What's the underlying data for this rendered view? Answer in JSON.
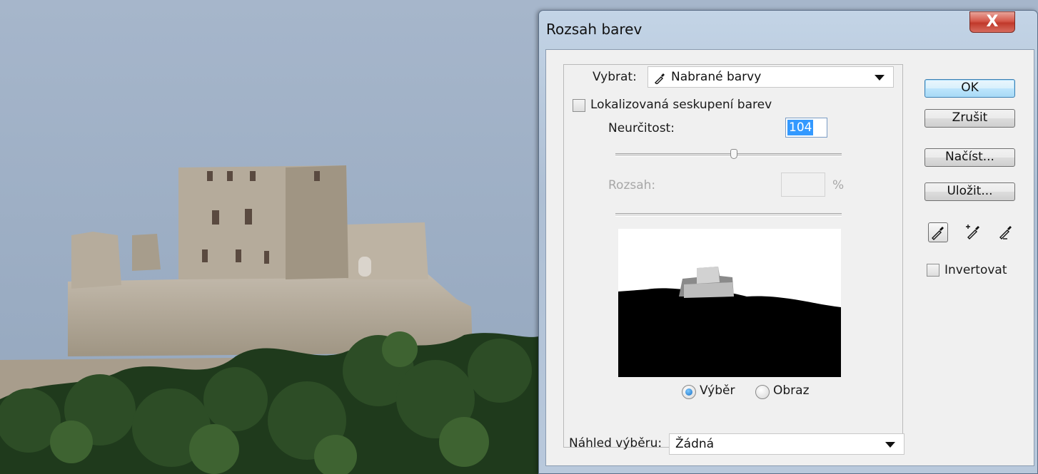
{
  "dialog": {
    "title": "Rozsah barev",
    "select_label": "Vybrat:",
    "select_value": "Nabrané barvy",
    "localized_label": "Lokalizovaná seskupení barev",
    "fuzziness_label": "Neurčitost:",
    "fuzziness_value": "104",
    "range_label": "Rozsah:",
    "range_unit": "%",
    "radio_selection": "Výběr",
    "radio_image": "Obraz",
    "preview_label": "Náhled výběru:",
    "preview_value": "Žádná",
    "ok_label": "OK",
    "cancel_label": "Zrušit",
    "load_label": "Načíst...",
    "save_label": "Uložit...",
    "invert_label": "Invertovat",
    "close_glyph": "X"
  },
  "colors": {
    "accent_selection": "#3399ff",
    "default_button": "#bee6fd",
    "title_bar": "#b9c9dc"
  }
}
